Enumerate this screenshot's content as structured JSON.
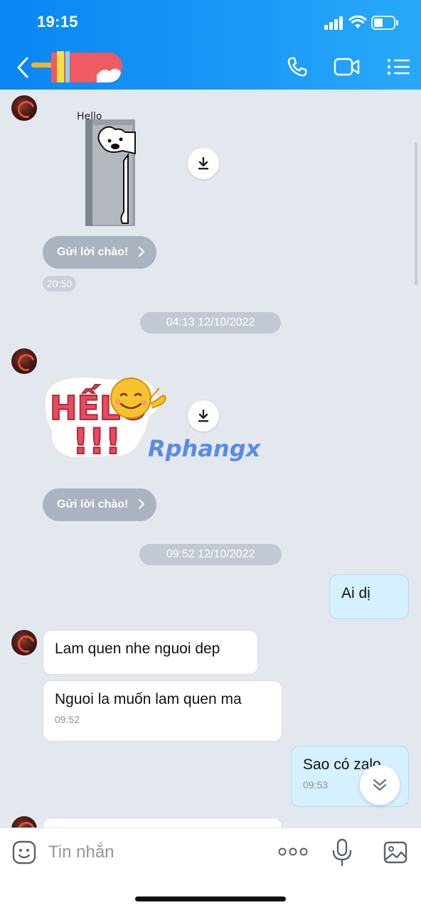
{
  "status_bar": {
    "time": "19:15"
  },
  "header": {
    "icons": [
      "back-icon",
      "sticker-avatar",
      "phone-icon",
      "video-call-icon",
      "menu-list-icon"
    ]
  },
  "messages": {
    "sticker1_text": "Hello",
    "greet_label": "Gửi lời chào!",
    "time_1": "20:50",
    "date_1": "04:13 12/10/2022",
    "sticker2_text": "HẾLO",
    "watermark": "Rphangx",
    "greet_label_2": "Gửi lời chào!",
    "date_2": "09:52 12/10/2022",
    "out_1": "Ai dị",
    "in_1": "Lam quen nhe nguoi dep",
    "in_2": "Nguoi la muốn lam quen ma",
    "in_2_time": "09:52",
    "out_2": "Sao có zalo",
    "out_2_time": "09:53"
  },
  "input": {
    "placeholder": "Tin nhắn"
  },
  "colors": {
    "header": "#0a86f3",
    "incoming": "#ffffff",
    "outgoing": "#d5f0ff",
    "chat_bg": "#e3e8ef"
  }
}
